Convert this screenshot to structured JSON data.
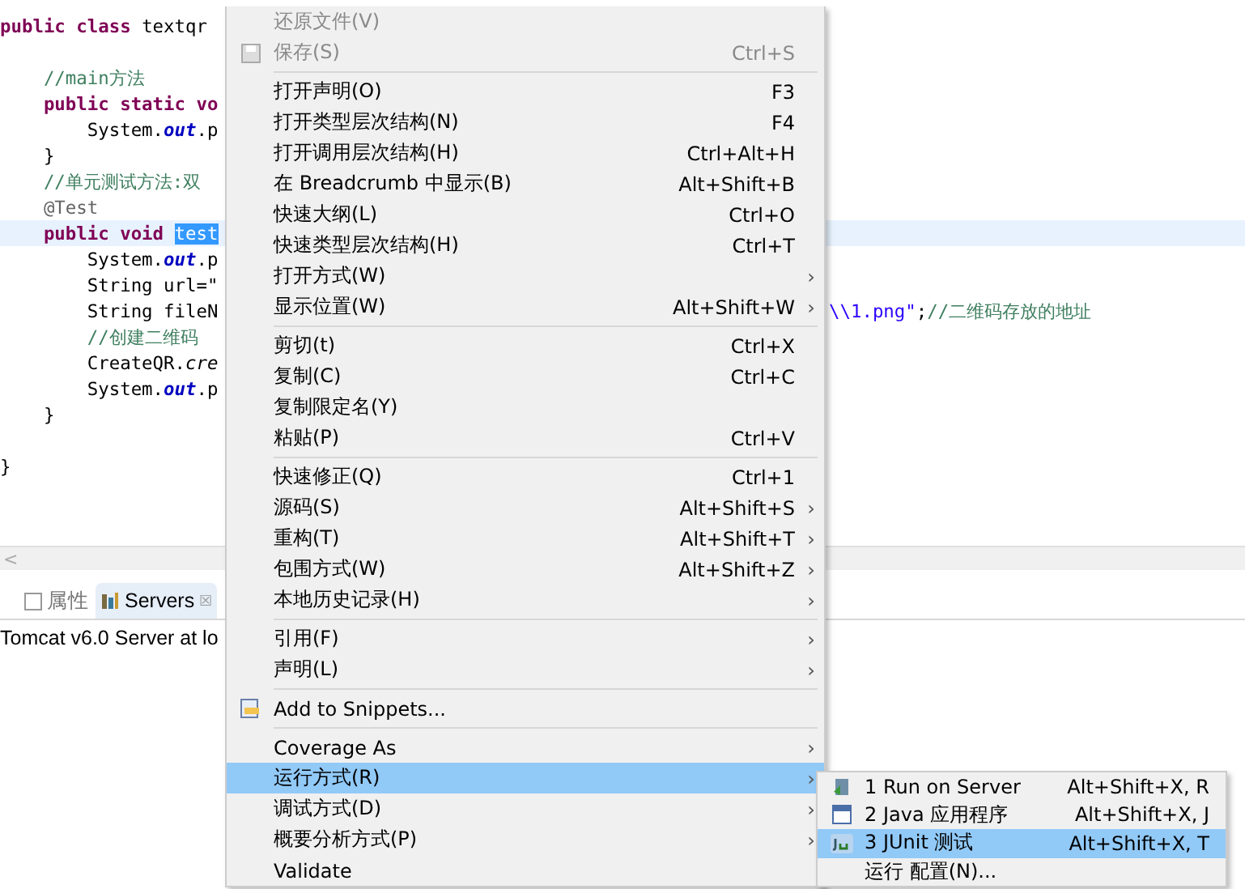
{
  "editor": {
    "lines": [
      {
        "current": false,
        "tokens": [
          {
            "kind": "keyword",
            "text": "public class"
          },
          {
            "kind": "plain",
            "text": " textqr"
          }
        ]
      },
      {
        "current": false
      },
      {
        "current": false,
        "tokens": [
          {
            "kind": "comment",
            "text": "    //main方法"
          }
        ]
      },
      {
        "current": false,
        "tokens": [
          {
            "kind": "keyword",
            "text": "    public static vo"
          }
        ]
      },
      {
        "current": false,
        "tokens": [
          {
            "kind": "plain",
            "text": "        System."
          },
          {
            "kind": "field",
            "text": "out"
          },
          {
            "kind": "plain",
            "text": ".p"
          }
        ]
      },
      {
        "current": false,
        "tokens": [
          {
            "kind": "plain",
            "text": "    }"
          }
        ]
      },
      {
        "current": false,
        "tokens": [
          {
            "kind": "comment",
            "text": "    //单元测试方法:双"
          }
        ]
      },
      {
        "current": false,
        "tokens": [
          {
            "kind": "annotation",
            "text": "    @Test"
          }
        ]
      },
      {
        "current": true,
        "tokens": [
          {
            "kind": "keyword",
            "text": "    public void "
          },
          {
            "kind": "selection",
            "text": "test"
          }
        ]
      },
      {
        "current": false,
        "tokens": [
          {
            "kind": "plain",
            "text": "        System."
          },
          {
            "kind": "field",
            "text": "out"
          },
          {
            "kind": "plain",
            "text": ".p"
          }
        ]
      },
      {
        "current": false,
        "tokens": [
          {
            "kind": "plain",
            "text": "        String url=\""
          }
        ]
      },
      {
        "current": false,
        "tokens": [
          {
            "kind": "plain",
            "text": "        String fileN"
          }
        ],
        "tail": [
          {
            "kind": "string",
            "text": "\\\\1.png\""
          },
          {
            "kind": "plain",
            "text": ";"
          },
          {
            "kind": "comment",
            "text": "//二维码存放的地址"
          }
        ]
      },
      {
        "current": false,
        "tokens": [
          {
            "kind": "comment",
            "text": "        //创建二维码"
          }
        ]
      },
      {
        "current": false,
        "tokens": [
          {
            "kind": "plain",
            "text": "        CreateQR."
          },
          {
            "kind": "method",
            "text": "cre"
          }
        ]
      },
      {
        "current": false,
        "tokens": [
          {
            "kind": "plain",
            "text": "        System."
          },
          {
            "kind": "field",
            "text": "out"
          },
          {
            "kind": "plain",
            "text": ".p"
          }
        ]
      },
      {
        "current": false,
        "tokens": [
          {
            "kind": "plain",
            "text": "    }"
          }
        ]
      },
      {
        "current": false
      },
      {
        "current": false,
        "tokens": [
          {
            "kind": "plain",
            "text": "}"
          }
        ]
      }
    ],
    "scroll_left": "<"
  },
  "panel": {
    "tabs": [
      {
        "label": "属性",
        "selected": false
      },
      {
        "label": "Servers",
        "selected": true,
        "close": "☒"
      }
    ],
    "rows": [
      "Tomcat v6.0 Server at lo"
    ]
  },
  "context_menu": {
    "items": [
      {
        "kind": "item",
        "label": "还原文件(V)",
        "disabled": true,
        "selected": false
      },
      {
        "kind": "item",
        "label": "保存(S)",
        "shortcut": "Ctrl+S",
        "disabled": true,
        "selected": false
      },
      {
        "kind": "separator"
      },
      {
        "kind": "item",
        "label": "打开声明(O)",
        "shortcut": "F3",
        "disabled": false,
        "selected": false
      },
      {
        "kind": "item",
        "label": "打开类型层次结构(N)",
        "shortcut": "F4",
        "disabled": false,
        "selected": false
      },
      {
        "kind": "item",
        "label": "打开调用层次结构(H)",
        "shortcut": "Ctrl+Alt+H",
        "disabled": false,
        "selected": false
      },
      {
        "kind": "item",
        "label": "在 Breadcrumb 中显示(B)",
        "shortcut": "Alt+Shift+B",
        "disabled": false,
        "selected": false
      },
      {
        "kind": "item",
        "label": "快速大纲(L)",
        "shortcut": "Ctrl+O",
        "disabled": false,
        "selected": false
      },
      {
        "kind": "item",
        "label": "快速类型层次结构(H)",
        "shortcut": "Ctrl+T",
        "disabled": false,
        "selected": false
      },
      {
        "kind": "item",
        "label": "打开方式(W)",
        "submenu": "›",
        "disabled": false,
        "selected": false
      },
      {
        "kind": "item",
        "label": "显示位置(W)",
        "shortcut": "Alt+Shift+W",
        "submenu": "›",
        "disabled": false,
        "selected": false
      },
      {
        "kind": "separator"
      },
      {
        "kind": "item",
        "label": "剪切(t)",
        "shortcut": "Ctrl+X",
        "disabled": false,
        "selected": false
      },
      {
        "kind": "item",
        "label": "复制(C)",
        "shortcut": "Ctrl+C",
        "disabled": false,
        "selected": false
      },
      {
        "kind": "item",
        "label": "复制限定名(Y)",
        "disabled": false,
        "selected": false
      },
      {
        "kind": "item",
        "label": "粘贴(P)",
        "shortcut": "Ctrl+V",
        "disabled": false,
        "selected": false
      },
      {
        "kind": "separator"
      },
      {
        "kind": "item",
        "label": "快速修正(Q)",
        "shortcut": "Ctrl+1",
        "disabled": false,
        "selected": false
      },
      {
        "kind": "item",
        "label": "源码(S)",
        "shortcut": "Alt+Shift+S",
        "submenu": "›",
        "disabled": false,
        "selected": false
      },
      {
        "kind": "item",
        "label": "重构(T)",
        "shortcut": "Alt+Shift+T",
        "submenu": "›",
        "disabled": false,
        "selected": false
      },
      {
        "kind": "item",
        "label": "包围方式(W)",
        "shortcut": "Alt+Shift+Z",
        "submenu": "›",
        "disabled": false,
        "selected": false
      },
      {
        "kind": "item",
        "label": "本地历史记录(H)",
        "submenu": "›",
        "disabled": false,
        "selected": false
      },
      {
        "kind": "separator"
      },
      {
        "kind": "item",
        "label": "引用(F)",
        "submenu": "›",
        "disabled": false,
        "selected": false
      },
      {
        "kind": "item",
        "label": "声明(L)",
        "submenu": "›",
        "disabled": false,
        "selected": false
      },
      {
        "kind": "separator"
      },
      {
        "kind": "item",
        "label": "Add to Snippets...",
        "disabled": false,
        "selected": false
      },
      {
        "kind": "separator"
      },
      {
        "kind": "item",
        "label": "Coverage As",
        "submenu": "›",
        "disabled": false,
        "selected": false
      },
      {
        "kind": "item",
        "label": "运行方式(R)",
        "submenu": "›",
        "disabled": false,
        "selected": true
      },
      {
        "kind": "item",
        "label": "调试方式(D)",
        "submenu": "›",
        "disabled": false,
        "selected": false
      },
      {
        "kind": "item",
        "label": "概要分析方式(P)",
        "submenu": "›",
        "disabled": false,
        "selected": false
      },
      {
        "kind": "item",
        "label": "Validate",
        "disabled": false,
        "selected": false
      }
    ]
  },
  "submenu": {
    "items": [
      {
        "label": "1 Run on Server",
        "shortcut": "Alt+Shift+X, R",
        "selected": false
      },
      {
        "label": "2 Java 应用程序",
        "shortcut": "Alt+Shift+X, J",
        "selected": false
      },
      {
        "label": "3 JUnit 测试",
        "shortcut": "Alt+Shift+X, T",
        "selected": true
      },
      {
        "label": "运行 配置(N)...",
        "selected": false
      }
    ]
  }
}
